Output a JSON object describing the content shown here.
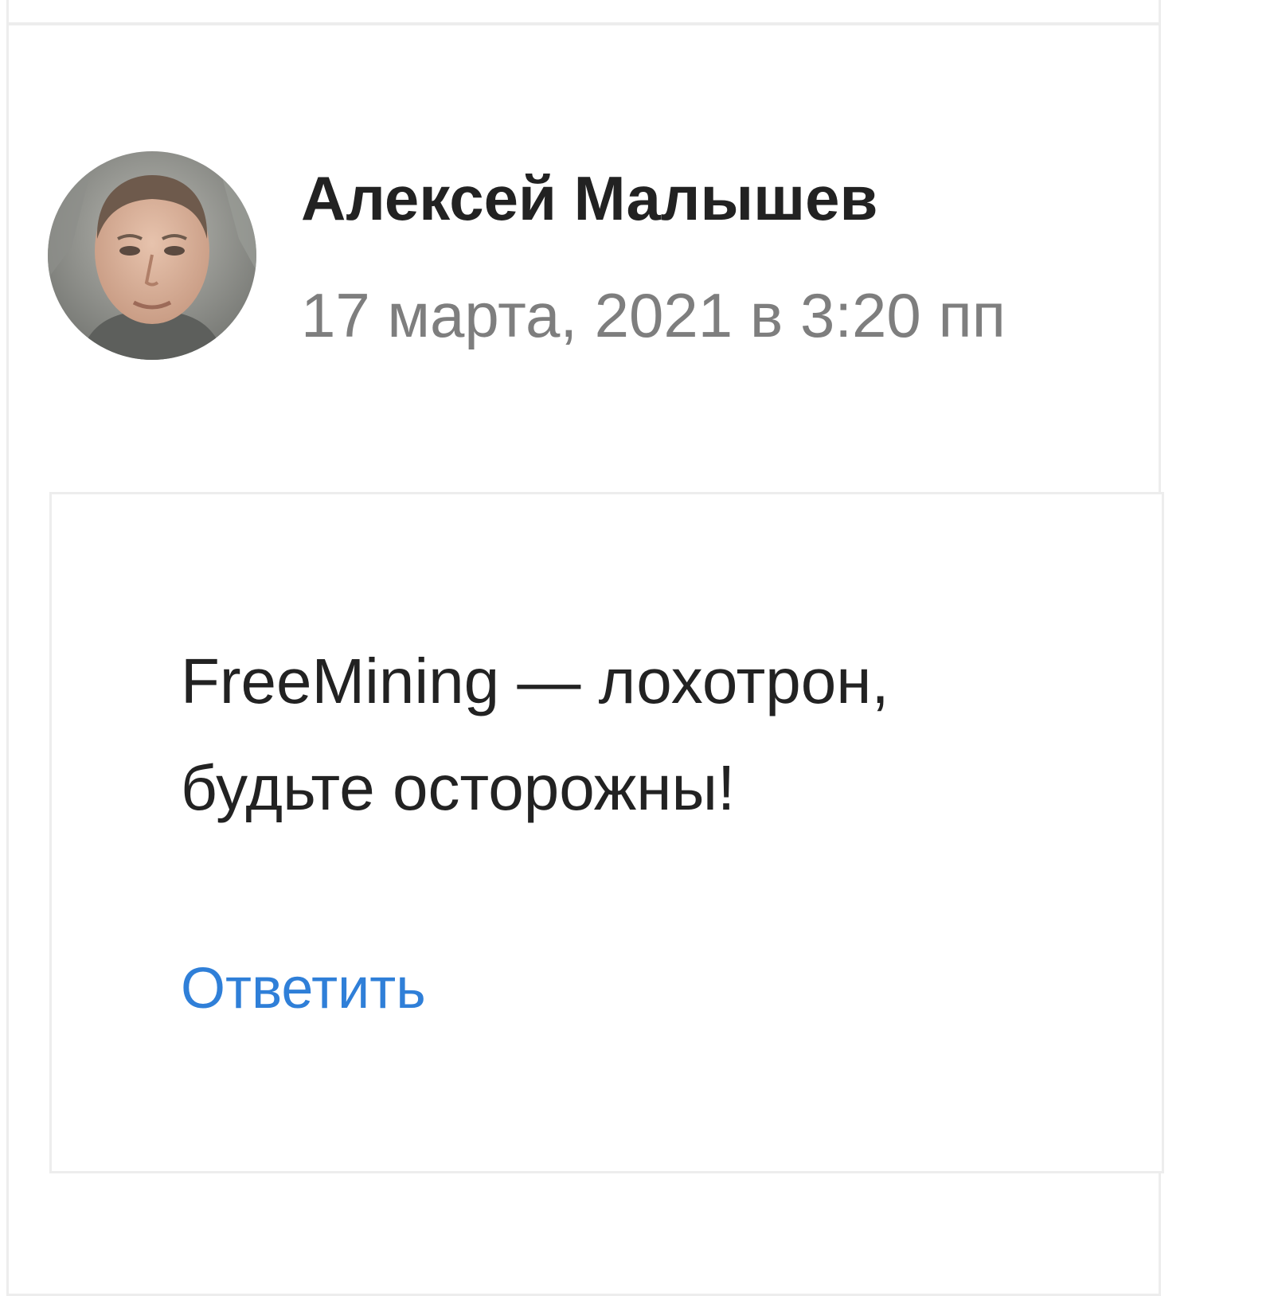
{
  "comment": {
    "author": "Алексей Малышев",
    "date": "17 марта, 2021 в 3:20 пп",
    "text": "FreeMining — лохотрон, будьте осторожны!",
    "reply_label": "Ответить"
  },
  "colors": {
    "author": "#222222",
    "date": "#7e7e7e",
    "link": "#2f7fd8",
    "border": "#ededed"
  },
  "icons": {
    "avatar": "user-avatar-photo"
  }
}
